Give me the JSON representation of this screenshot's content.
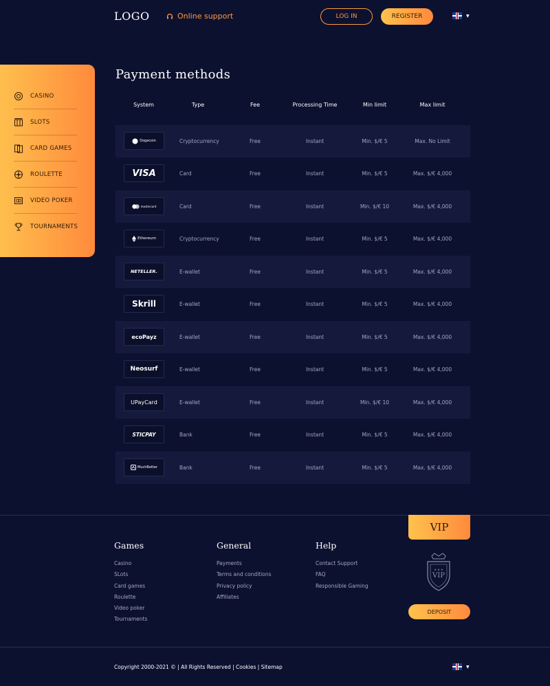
{
  "header": {
    "logo": "LOGO",
    "support_label": "Online support",
    "login_label": "LOG IN",
    "register_label": "REGISTER",
    "language": "English"
  },
  "sidebar": {
    "items": [
      {
        "label": "CASINO",
        "icon": "casino-chip-icon"
      },
      {
        "label": "SLOTS",
        "icon": "slot-machine-icon"
      },
      {
        "label": "CARD GAMES",
        "icon": "playing-cards-icon"
      },
      {
        "label": "ROULETTE",
        "icon": "roulette-wheel-icon"
      },
      {
        "label": "VIDEO POKER",
        "icon": "video-poker-icon"
      },
      {
        "label": "TOURNAMENTS",
        "icon": "trophy-icon"
      }
    ]
  },
  "main": {
    "title": "Payment methods",
    "columns": [
      "System",
      "Type",
      "Fee",
      "Processing Time",
      "Min limit",
      "Max limit"
    ],
    "rows": [
      {
        "system": "Dogecoin",
        "type": "Cryptocurrency",
        "fee": "Free",
        "time": "Instant",
        "min": "Min. $/€ 5",
        "max": "Max. No Limit"
      },
      {
        "system": "VISA",
        "type": "Card",
        "fee": "Free",
        "time": "Instant",
        "min": "Min. $/€ 5",
        "max": "Max. $/€ 4,000"
      },
      {
        "system": "mastercard",
        "type": "Card",
        "fee": "Free",
        "time": "Instant",
        "min": "Min. $/€ 10",
        "max": "Max. $/€ 4,000"
      },
      {
        "system": "Ethereum",
        "type": "Cryptocurrency",
        "fee": "Free",
        "time": "Instant",
        "min": "Min. $/€ 5",
        "max": "Max. $/€ 4,000"
      },
      {
        "system": "NETELLER.",
        "type": "E-wallet",
        "fee": "Free",
        "time": "Instant",
        "min": "Min. $/€ 5",
        "max": "Max. $/€ 4,000"
      },
      {
        "system": "Skrill",
        "type": "E-wallet",
        "fee": "Free",
        "time": "Instant",
        "min": "Min. $/€ 5",
        "max": "Max. $/€ 4,000"
      },
      {
        "system": "ecoPayz",
        "type": "E-wallet",
        "fee": "Free",
        "time": "Instant",
        "min": "Min. $/€ 5",
        "max": "Max. $/€ 4,000"
      },
      {
        "system": "Neosurf",
        "type": "E-wallet",
        "fee": "Free",
        "time": "Instant",
        "min": "Min. $/€ 5",
        "max": "Max. $/€ 4,000"
      },
      {
        "system": "UPayCard",
        "type": "E-wallet",
        "fee": "Free",
        "time": "Instant",
        "min": "Min. $/€ 10",
        "max": "Max. $/€ 4,000"
      },
      {
        "system": "STICPAY",
        "type": "Bank",
        "fee": "Free",
        "time": "Instant",
        "min": "Min. $/€ 5",
        "max": "Max. $/€ 4,000"
      },
      {
        "system": "MuchBetter",
        "type": "Bank",
        "fee": "Free",
        "time": "Instant",
        "min": "Min. $/€ 5",
        "max": "Max. $/€ 4,000"
      }
    ]
  },
  "footer": {
    "columns": [
      {
        "title": "Games",
        "links": [
          "Casino",
          "SLots",
          "Card games",
          "Roulette",
          "Video poker",
          "Tournaments"
        ]
      },
      {
        "title": "General",
        "links": [
          "Payments",
          "Terms and conditions",
          "Privacy policy",
          "Affiliates"
        ]
      },
      {
        "title": "Help",
        "links": [
          "Contact Support",
          "FAQ",
          "Responsible Gaming"
        ]
      }
    ],
    "vip_label": "VIP",
    "badge_text": "VIP",
    "deposit_label": "DEPOSIT",
    "copyright": "Copyright 2000-2021 © | All Rights Reserved | Cookies | Sitemap"
  },
  "colors": {
    "background": "#0d1130",
    "accent": "#ff9a3c",
    "row_shade": "#151a3d"
  }
}
